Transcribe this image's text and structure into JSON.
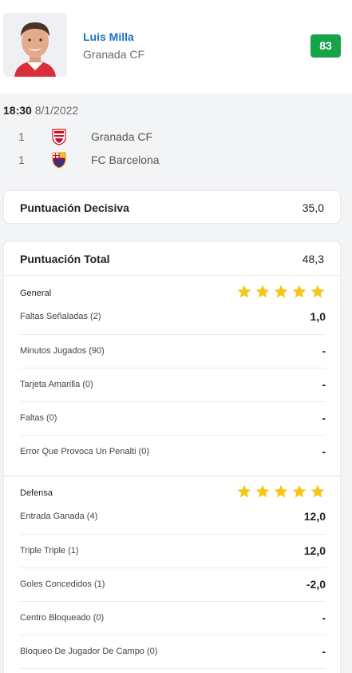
{
  "player": {
    "name": "Luis Milla",
    "team": "Granada CF",
    "rating": "83"
  },
  "match": {
    "time": "18:30",
    "date": "8/1/2022",
    "teams": [
      {
        "goals": "1",
        "name": "Granada CF"
      },
      {
        "goals": "1",
        "name": "FC Barcelona"
      }
    ]
  },
  "decisive": {
    "label": "Puntuación Decisiva",
    "value": "35,0"
  },
  "total": {
    "label": "Puntuación Total",
    "value": "48,3",
    "sections": [
      {
        "name": "General",
        "stars": 5,
        "rows": [
          {
            "label": "Faltas Señaladas (2)",
            "value": "1,0"
          },
          {
            "label": "Minutos Jugados (90)",
            "value": "-"
          },
          {
            "label": "Tarjeta Amarilla (0)",
            "value": "-"
          },
          {
            "label": "Faltas (0)",
            "value": "-"
          },
          {
            "label": "Error Que Provoca Un Penalti (0)",
            "value": "-"
          }
        ]
      },
      {
        "name": "Defensa",
        "stars": 5,
        "rows": [
          {
            "label": "Entrada Ganada (4)",
            "value": "12,0"
          },
          {
            "label": "Triple Triple (1)",
            "value": "12,0"
          },
          {
            "label": "Goles Concedidos (1)",
            "value": "-2,0"
          },
          {
            "label": "Centro Bloqueado (0)",
            "value": "-"
          },
          {
            "label": "Bloqueo De Jugador De Campo (0)",
            "value": "-"
          }
        ]
      }
    ]
  },
  "colors": {
    "rating_badge": "#16a34a",
    "player_name": "#1a73c8",
    "star": "#f5c518"
  }
}
